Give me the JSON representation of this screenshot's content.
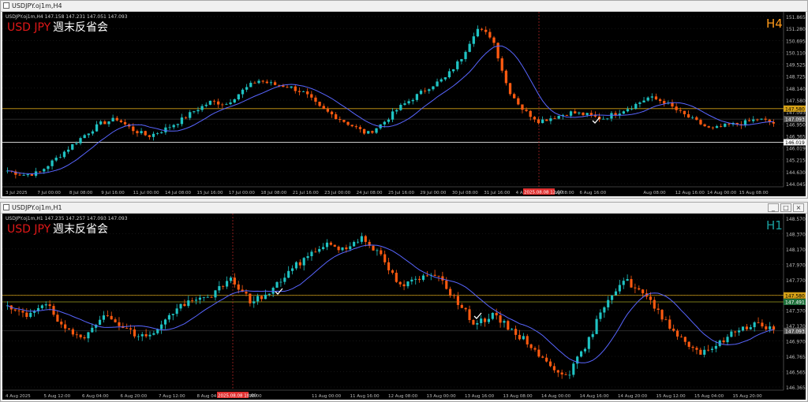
{
  "colors": {
    "bull": "#1fc3c3",
    "bear": "#ff5a10",
    "ma": "#5865ff",
    "grid": "#2a2a2a",
    "axis_text": "#bdbdbd",
    "orange_line": "#d4a017",
    "white_line": "#e8e8e8",
    "title_red": "#e01818",
    "tf_h4": "#ff9a1a",
    "tf_h1": "#1aa0a0",
    "redline": "#e03030"
  },
  "top": {
    "window_title": "USDJPY.oj1m,H4",
    "info_line": "USDJPY.oj1m,H4  147.158 147.231 147.051 147.093",
    "symbol": "USD JPY",
    "subtitle": "週末反省会",
    "timeframe": "H4",
    "price_ticks": [
      "151.865",
      "151.280",
      "150.695",
      "150.110",
      "149.525",
      "148.725",
      "148.140",
      "147.580",
      "147.093",
      "146.950",
      "146.365",
      "146.019",
      "145.215",
      "144.630",
      "144.045"
    ],
    "price_tag_orange": "147.580",
    "price_tag_current": "147.093",
    "price_tag_white": "146.019",
    "time_labels": [
      "3 Jul 2025",
      "7 Jul 00:00",
      "8 Jul 08:00",
      "9 Jul 16:00",
      "11 Jul 00:00",
      "14 Jul 08:00",
      "15 Jul 16:00",
      "17 Jul 00:00",
      "18 Jul 08:00",
      "21 Jul 16:00",
      "23 Jul 00:00",
      "24 Jul 08:00",
      "25 Jul 16:00",
      "29 Jul 00:00",
      "30 Jul 08:00",
      "31 Jul 16:00",
      "4 Aug 00:00",
      "5 Aug 08:00",
      "6 Aug 16:00",
      "2025.08.08 12:00",
      "Aug 08:00",
      "12 Aug 16:00",
      "14 Aug 00:00",
      "15 Aug 08:00"
    ],
    "close_path": [
      144.7,
      144.5,
      144.6,
      145.2,
      145.8,
      146.4,
      146.9,
      147.1,
      146.6,
      146.3,
      146.6,
      147.0,
      147.5,
      147.9,
      147.8,
      148.4,
      148.9,
      148.7,
      148.6,
      148.3,
      147.6,
      147.2,
      146.8,
      146.4,
      146.9,
      147.6,
      148.1,
      148.6,
      149.0,
      149.9,
      151.3,
      150.9,
      148.5,
      147.5,
      147.0,
      147.2,
      147.4,
      147.3,
      147.1,
      147.4,
      147.7,
      148.1,
      147.9,
      147.4,
      147.0,
      146.6,
      146.8,
      146.9,
      147.1,
      146.9
    ]
  },
  "bottom": {
    "window_title": "USDJPY.oj1m,H1",
    "info_line": "USDJPY.oj1m,H1  147.235 147.257 147.093 147.093",
    "symbol": "USD JPY",
    "subtitle": "週末反省会",
    "timeframe": "H1",
    "price_ticks": [
      "148.570",
      "148.370",
      "148.170",
      "147.970",
      "147.770",
      "147.580",
      "147.370",
      "147.170",
      "146.970",
      "146.765",
      "146.565",
      "146.365"
    ],
    "price_tag_orange": "147.580",
    "price_tag_mid": "147.491",
    "price_tag_current": "147.093",
    "time_labels": [
      "4 Aug 2025",
      "5 Aug 12:00",
      "6 Aug 04:00",
      "6 Aug 20:00",
      "7 Aug 12:00",
      "8 Aug 04:00",
      "8 Aug 20:00",
      "2025.08.08 10:00",
      "11 Aug 00:00",
      "11 Aug 16:00",
      "12 Aug 08:00",
      "13 Aug 00:00",
      "13 Aug 16:00",
      "13 Aug 08:00",
      "14 Aug 00:00",
      "14 Aug 16:00",
      "14 Aug 20:00",
      "15 Aug 12:00",
      "15 Aug 04:00",
      "15 Aug 20:00"
    ],
    "close_path": [
      147.4,
      147.3,
      147.5,
      147.1,
      147.0,
      147.3,
      147.2,
      147.0,
      147.1,
      147.4,
      147.5,
      147.6,
      147.8,
      147.5,
      147.6,
      147.9,
      148.1,
      148.3,
      148.2,
      148.4,
      148.1,
      147.7,
      147.8,
      147.9,
      147.5,
      147.2,
      147.3,
      147.1,
      146.9,
      146.6,
      146.5,
      146.9,
      147.5,
      147.8,
      147.6,
      147.3,
      147.0,
      146.8,
      146.9,
      147.1,
      147.2,
      147.1
    ]
  },
  "window_buttons": [
    "_",
    "□",
    "×"
  ]
}
